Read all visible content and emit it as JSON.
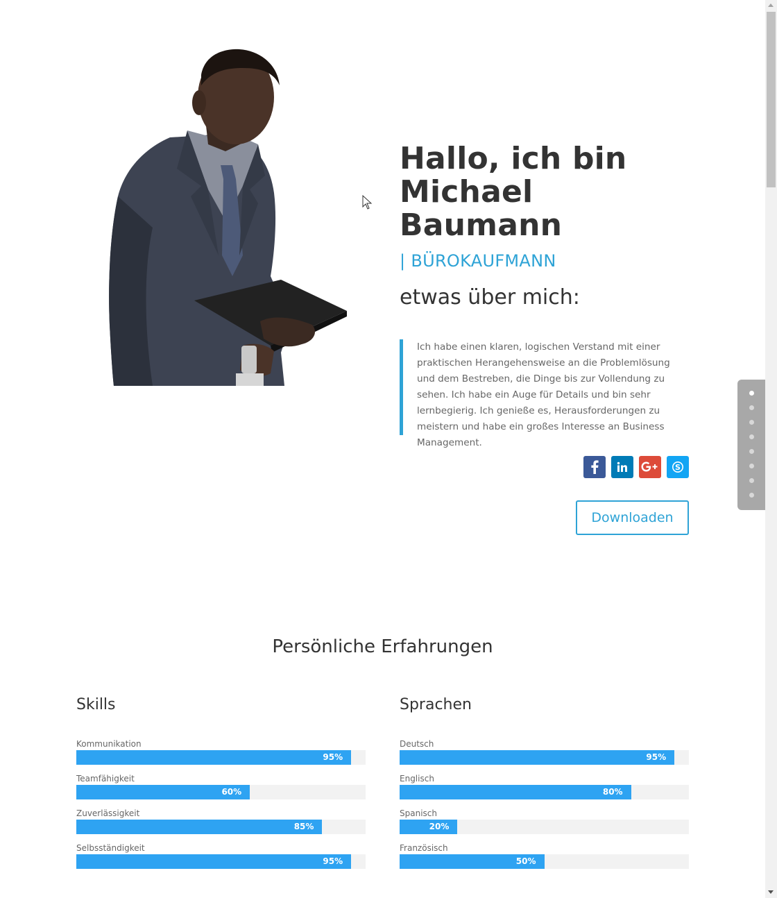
{
  "hero": {
    "title": "Hallo, ich bin Michael Baumann",
    "subtitle": "| BÜROKAUFMANN",
    "about_heading": "etwas über mich:",
    "about_text": "Ich habe einen klaren, logischen Verstand mit einer praktischen Herangehensweise an die Problemlösung und dem Bestreben, die Dinge bis zur Vollendung zu sehen. Ich habe ein Auge für Details und bin sehr lernbegierig. Ich genieße es, Herausforderungen zu meistern und habe ein großes Interesse an Business Management.",
    "download_label": "Downloaden"
  },
  "social": [
    {
      "icon": "facebook-icon",
      "glyph": "f",
      "color": "#3b5998"
    },
    {
      "icon": "linkedin-icon",
      "glyph": "in",
      "color": "#007bb6"
    },
    {
      "icon": "google-plus-icon",
      "glyph": "G+",
      "color": "#dd4b39"
    },
    {
      "icon": "skype-icon",
      "glyph": "S",
      "color": "#12a5f4"
    }
  ],
  "dot_nav": {
    "count": 8,
    "active_index": 0
  },
  "experience": {
    "title": "Persönliche Erfahrungen",
    "skills": {
      "heading": "Skills",
      "items": [
        {
          "label": "Kommunikation",
          "percent": 95,
          "percent_text": "95%"
        },
        {
          "label": "Teamfähigkeit",
          "percent": 60,
          "percent_text": "60%"
        },
        {
          "label": "Zuverlässigkeit",
          "percent": 85,
          "percent_text": "85%"
        },
        {
          "label": "Selbsständigkeit",
          "percent": 95,
          "percent_text": "95%"
        }
      ]
    },
    "languages": {
      "heading": "Sprachen",
      "items": [
        {
          "label": "Deutsch",
          "percent": 95,
          "percent_text": "95%"
        },
        {
          "label": "Englisch",
          "percent": 80,
          "percent_text": "80%"
        },
        {
          "label": "Spanisch",
          "percent": 20,
          "percent_text": "20%"
        },
        {
          "label": "Französisch",
          "percent": 50,
          "percent_text": "50%"
        }
      ]
    }
  },
  "colors": {
    "accent": "#2ea3d6",
    "bar": "#2ea3f2"
  }
}
